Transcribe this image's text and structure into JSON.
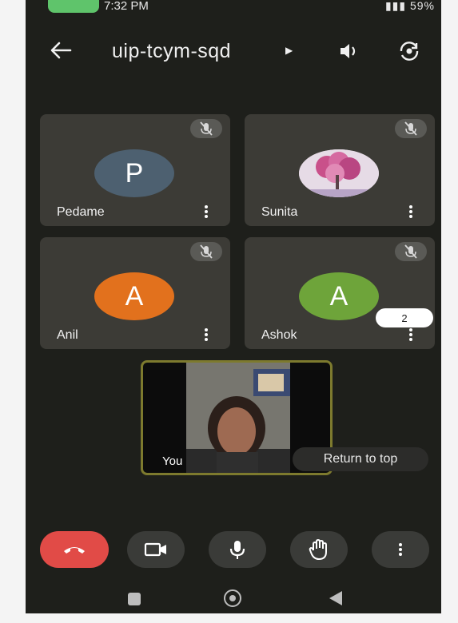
{
  "status_bar": {
    "time": "7:32 PM",
    "battery": "59%"
  },
  "header": {
    "meeting_code": "uip-tcym-sqd"
  },
  "participants": [
    {
      "name": "Pedame",
      "initial": "P",
      "color": "#4d6070"
    },
    {
      "name": "Sunita",
      "initial": "",
      "color": "#d6d0d8"
    },
    {
      "name": "Anil",
      "initial": "A",
      "color": "#e2711d"
    },
    {
      "name": "Ashok",
      "initial": "A",
      "color": "#6ea43a"
    }
  ],
  "self_view": {
    "label": "You"
  },
  "return_to_top": "Return to top",
  "hidden_count": "2",
  "colors": {
    "background": "#1e1f1b",
    "tile": "#3c3b36",
    "end_call": "#e14b47",
    "self_border": "#7d7a2e"
  },
  "icons": [
    "back-arrow-icon",
    "speaker-icon",
    "camera-flip-icon",
    "mic-off-icon",
    "more-vert-icon",
    "end-call-icon",
    "video-icon",
    "mic-icon",
    "raise-hand-icon",
    "recents-icon",
    "home-icon",
    "back-nav-icon"
  ]
}
